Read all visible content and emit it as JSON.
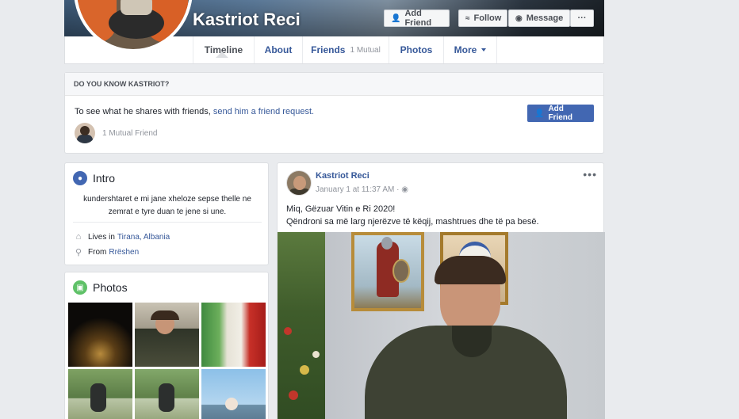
{
  "profile": {
    "name": "Kastriot Reci"
  },
  "cover_buttons": {
    "add_friend": "Add Friend",
    "follow": "Follow",
    "message": "Message",
    "more": "···"
  },
  "nav": {
    "tabs": [
      {
        "label": "Timeline"
      },
      {
        "label": "About"
      },
      {
        "label": "Friends",
        "sub": "1 Mutual"
      },
      {
        "label": "Photos"
      },
      {
        "label": "More"
      }
    ]
  },
  "know_box": {
    "heading": "DO YOU KNOW KASTRIOT?",
    "text_prefix": "To see what he shares with friends, ",
    "link": "send him a friend request.",
    "mutual": "1 Mutual Friend",
    "button": "Add Friend"
  },
  "intro": {
    "title": "Intro",
    "bio": "kundershtaret e mi jane xheloze sepse thelle ne zemrat e tyre duan te jene si une.",
    "lives_label": "Lives in",
    "lives_value": "Tirana, Albania",
    "from_label": "From",
    "from_value": "Rrëshen"
  },
  "photos": {
    "title": "Photos"
  },
  "post": {
    "author": "Kastriot Reci",
    "date": "January 1 at 11:37 AM",
    "more": "•••",
    "line1": "Miq, Gëzuar Vitin e Ri 2020!",
    "line2": "Qëndroni sa më larg njerëzve të këqij, mashtrues dhe të pa besë."
  },
  "colors": {
    "link": "#365899",
    "primary_button": "#4267b2",
    "page_bg": "#e9ebee"
  }
}
